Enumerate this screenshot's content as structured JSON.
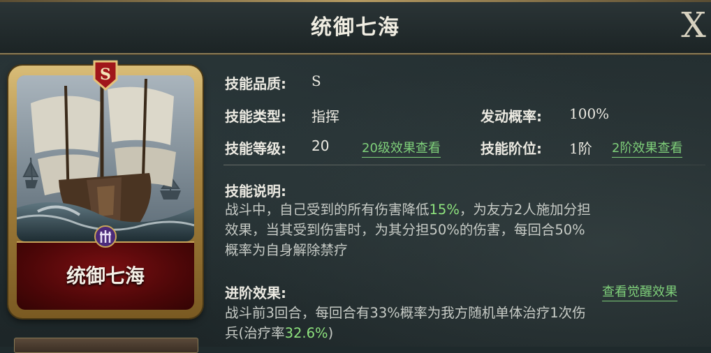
{
  "header": {
    "title": "统御七海",
    "close_label": "X"
  },
  "card": {
    "name": "统御七海",
    "grade": "S"
  },
  "skill": {
    "quality_label": "技能品质:",
    "quality_value": "S",
    "type_label": "技能类型:",
    "type_value": "指挥",
    "trigger_label": "发动概率:",
    "trigger_value": "100%",
    "level_label": "技能等级:",
    "level_value": "20",
    "level_link": "20级效果查看",
    "rank_label": "技能阶位:",
    "rank_value": "1阶",
    "rank_link": "2阶效果查看"
  },
  "description": {
    "label": "技能说明:",
    "line1_pre": "战斗中，自己受到的所有伤害降低",
    "line1_hl": "15%",
    "line1_post": "，为友方2人施加分担",
    "line2": "效果，当其受到伤害时，为其分担50%的伤害，每回合50%",
    "line3": "概率为自身解除禁疗"
  },
  "advanced": {
    "label": "进阶效果:",
    "link": "查看觉醒效果",
    "line1": "战斗前3回合，每回合有33%概率为我方随机单体治疗1次伤",
    "line2_pre": "兵(治疗率",
    "line2_hl": "32.6%",
    "line2_post": ")"
  },
  "colors": {
    "accent_green": "#8ee37e",
    "gold": "#b59a62",
    "card_red": "#6a0b0e"
  }
}
